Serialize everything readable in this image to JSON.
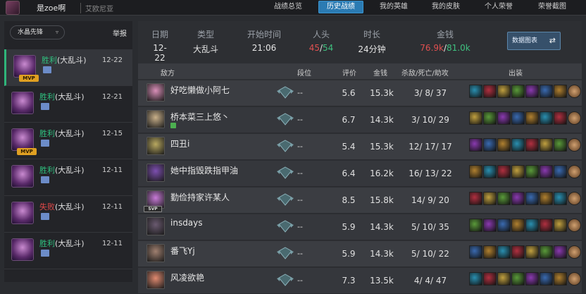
{
  "topbar": {
    "name": "是zoe啊",
    "server": "艾欧尼亚",
    "nav": [
      "战绩总览",
      "历史战绩",
      "我的英雄",
      "我的皮肤",
      "个人荣誉",
      "荣誉截图"
    ],
    "active_nav": "历史战绩"
  },
  "sidebar": {
    "filter_label": "水晶先锋",
    "filter_chevron": "chevron-down-icon",
    "report_label": "举报",
    "games": [
      {
        "result": "胜利",
        "mode": "(大乱斗)",
        "date": "12-22",
        "win": true,
        "mvp": true,
        "mvp_label": "MVP"
      },
      {
        "result": "胜利",
        "mode": "(大乱斗)",
        "date": "12-21",
        "win": true,
        "mvp": false
      },
      {
        "result": "胜利",
        "mode": "(大乱斗)",
        "date": "12-15",
        "win": true,
        "mvp": true,
        "mvp_label": "MVP"
      },
      {
        "result": "胜利",
        "mode": "(大乱斗)",
        "date": "12-11",
        "win": true,
        "mvp": false
      },
      {
        "result": "失败",
        "mode": "(大乱斗)",
        "date": "12-11",
        "win": false,
        "mvp": false
      },
      {
        "result": "胜利",
        "mode": "(大乱斗)",
        "date": "12-11",
        "win": true,
        "mvp": false
      }
    ]
  },
  "summary": {
    "date_label": "日期",
    "date": "12-22",
    "type_label": "类型",
    "type": "大乱斗",
    "start_label": "开始时间",
    "start": "21:06",
    "kills_label": "人头",
    "kills_red": "45",
    "kills_sep": "/",
    "kills_green": "54",
    "duration_label": "时长",
    "duration": "24分钟",
    "gold_label": "金钱",
    "gold_red": "76.9k",
    "gold_sep": "/",
    "gold_green": "81.0k",
    "chart_button": "数据图表"
  },
  "table": {
    "headers": {
      "team": "敌方",
      "rank": "段位",
      "score": "评价",
      "gold": "金钱",
      "kda": "杀敌/死亡/助攻",
      "items": "出装"
    },
    "rows": [
      {
        "name": "好吃懒做小阿七",
        "rank": "--",
        "score": "5.6",
        "gold": "15.3k",
        "kda": "3/ 8/ 37",
        "badge": "",
        "color": "#d98fb8"
      },
      {
        "name": "桥本菜三上悠丶",
        "rank": "--",
        "score": "6.7",
        "gold": "14.3k",
        "kda": "3/ 10/ 29",
        "badge": "",
        "color": "#c9b08a",
        "mark": true
      },
      {
        "name": "四丑i",
        "rank": "--",
        "score": "5.4",
        "gold": "15.3k",
        "kda": "12/ 17/ 17",
        "badge": "",
        "color": "#b8a860"
      },
      {
        "name": "她中指毁跌指甲油",
        "rank": "--",
        "score": "6.4",
        "gold": "16.2k",
        "kda": "16/ 13/ 22",
        "badge": "",
        "color": "#7d4fb0"
      },
      {
        "name": "勤俭持家许某人",
        "rank": "--",
        "score": "8.5",
        "gold": "15.8k",
        "kda": "14/ 9/ 20",
        "badge": "SVP",
        "color": "#c87ad8"
      },
      {
        "name": "insdays",
        "rank": "--",
        "score": "5.9",
        "gold": "14.3k",
        "kda": "5/ 10/ 35",
        "badge": "",
        "color": "#6a5a70"
      },
      {
        "name": "番飞Yj",
        "rank": "--",
        "score": "5.9",
        "gold": "14.3k",
        "kda": "5/ 10/ 22",
        "badge": "",
        "color": "#a08070"
      },
      {
        "name": "风凌欲艳",
        "rank": "--",
        "score": "7.3",
        "gold": "13.5k",
        "kda": "4/ 4/ 47",
        "badge": "",
        "color": "#e08a70"
      }
    ]
  },
  "colors": {
    "win": "#2fc07f",
    "lose": "#e04848",
    "accent": "#2b7bb3"
  }
}
